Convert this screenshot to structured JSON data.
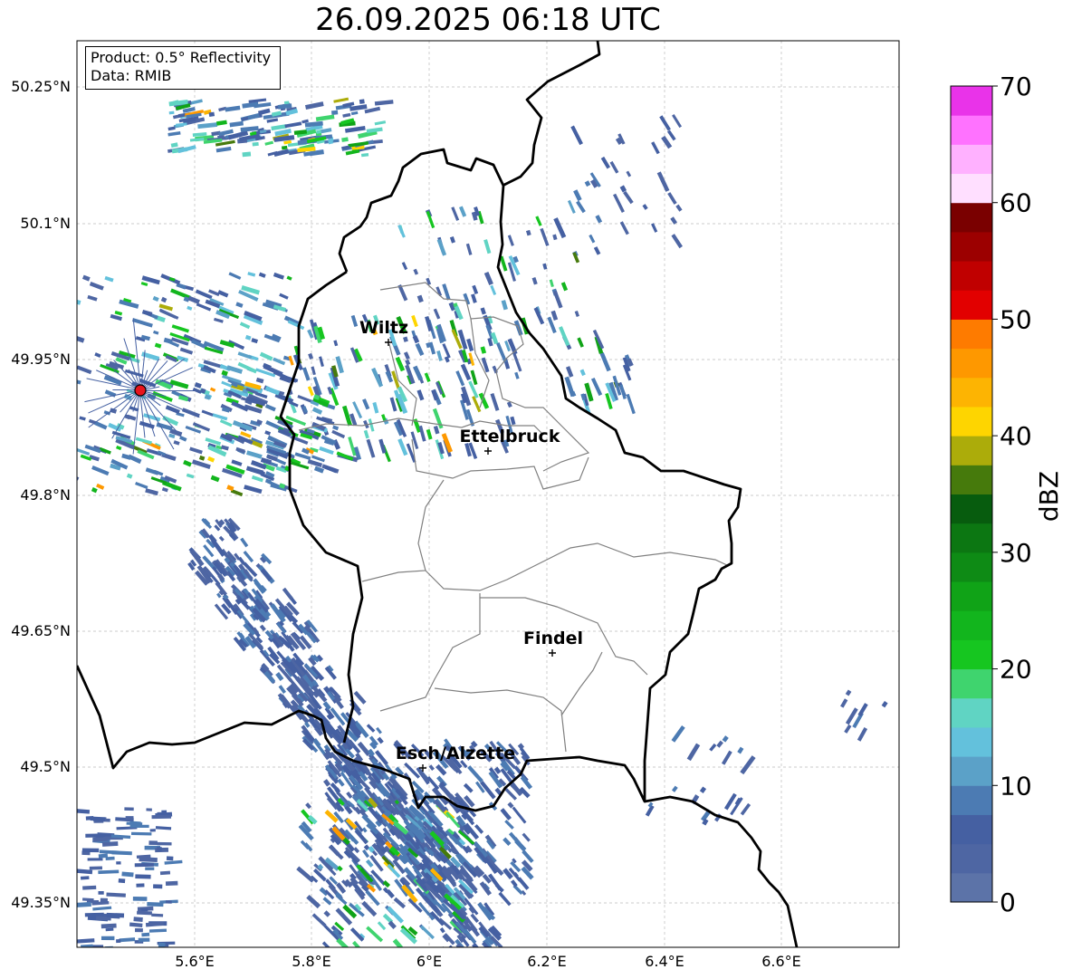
{
  "title": "26.09.2025 06:18 UTC",
  "info": {
    "product": "Product: 0.5° Reflectivity",
    "data": "Data: RMIB"
  },
  "axes": {
    "lon_ticks": [
      "5.6°E",
      "5.8°E",
      "6°E",
      "6.2°E",
      "6.4°E",
      "6.6°E"
    ],
    "lat_ticks": [
      "50.25°N",
      "50.1°N",
      "49.95°N",
      "49.8°N",
      "49.65°N",
      "49.5°N",
      "49.35°N"
    ]
  },
  "cities": [
    {
      "name": "Wiltz"
    },
    {
      "name": "Ettelbruck"
    },
    {
      "name": "Findel"
    },
    {
      "name": "Esch/Alzette"
    }
  ],
  "colorbar": {
    "label": "dBZ",
    "ticks": [
      "0",
      "10",
      "20",
      "30",
      "40",
      "50",
      "60",
      "70"
    ],
    "colors": [
      "#5c73a8",
      "#4e66a3",
      "#4560a2",
      "#4c7bb3",
      "#5ba1c8",
      "#63c1dc",
      "#60d4c3",
      "#3fd46e",
      "#16c620",
      "#12b51d",
      "#10a317",
      "#0e8b15",
      "#0c7712",
      "#075c0e",
      "#467a0c",
      "#acac0a",
      "#fed500",
      "#fdb402",
      "#fe9800",
      "#fe7b00",
      "#e20000",
      "#c00000",
      "#9c0000",
      "#7a0000",
      "#ffdfff",
      "#ffb1ff",
      "#ff72ff",
      "#e933e9"
    ]
  },
  "colors": {
    "border": "#000000",
    "canton": "#808080",
    "grid": "#bbbbbb",
    "radar_site": "#e8141c"
  }
}
